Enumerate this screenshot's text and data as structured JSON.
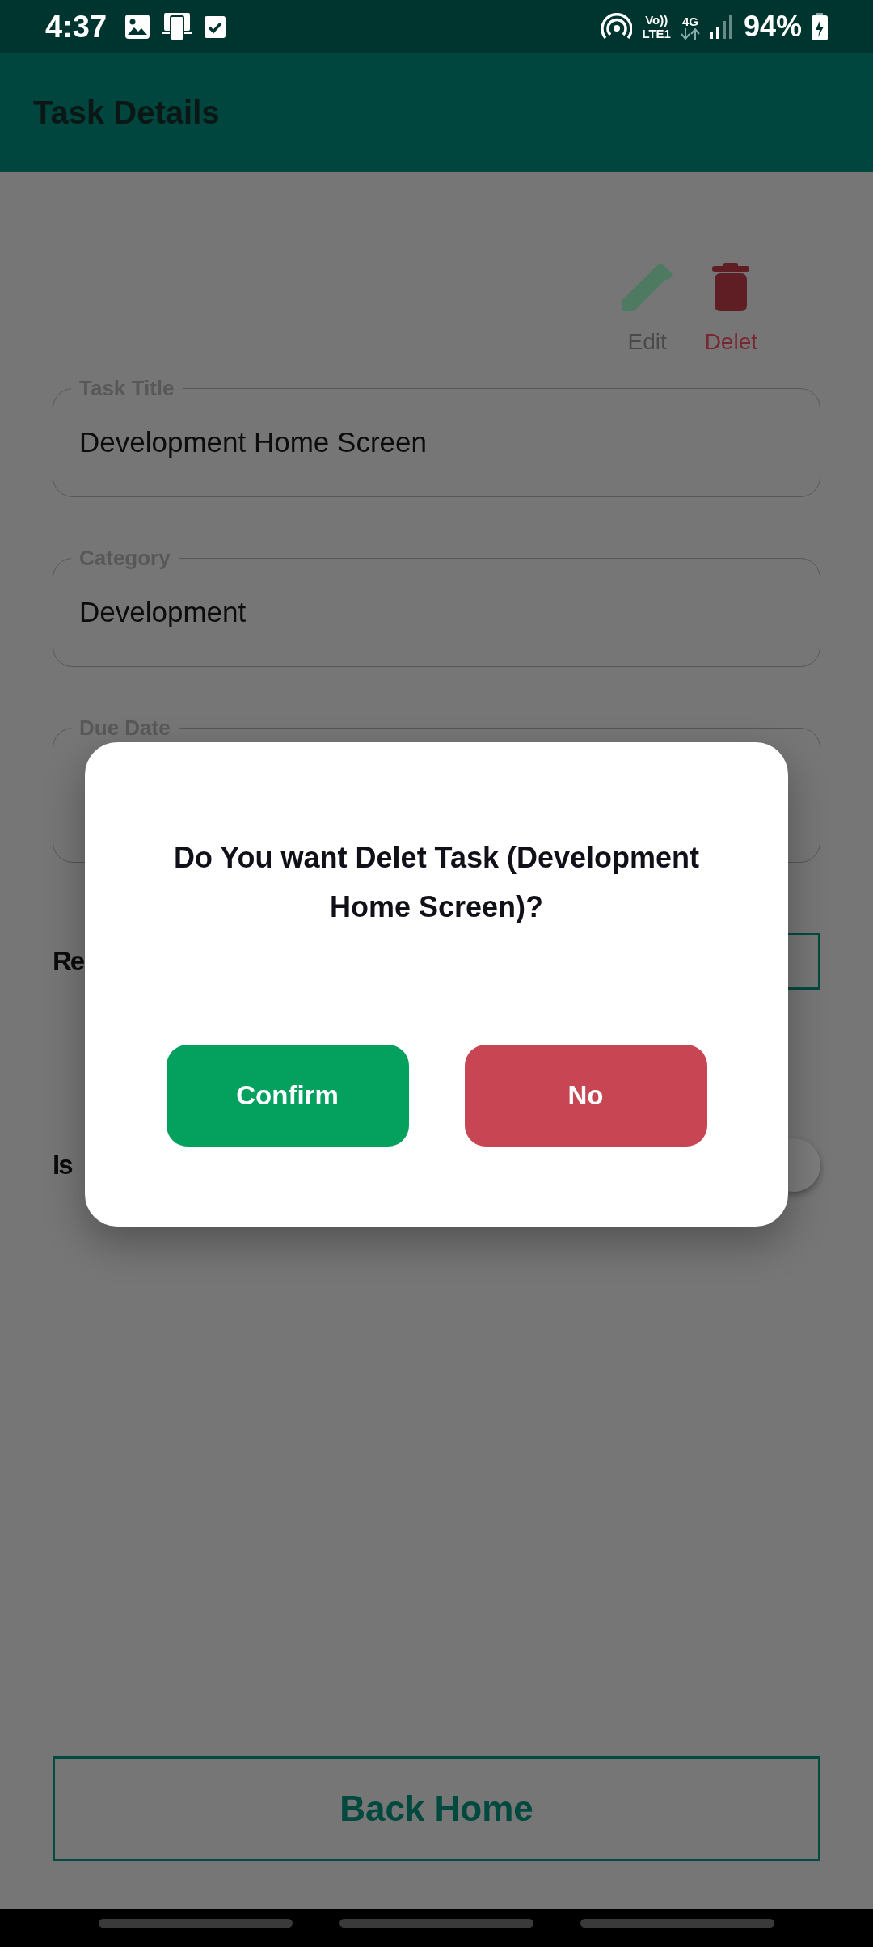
{
  "status_bar": {
    "time": "4:37",
    "volte": "Vo))",
    "lte": "LTE1",
    "network": "4G",
    "battery": "94%"
  },
  "app_bar": {
    "title": "Task Details"
  },
  "actions": [
    {
      "kind": "edit",
      "label": "Edit"
    },
    {
      "kind": "delete",
      "label": "Delet"
    }
  ],
  "fields": [
    {
      "label": "Task Title",
      "value": "Development Home Screen"
    },
    {
      "label": "Category",
      "value": "Development"
    },
    {
      "label": "Due Date"
    }
  ],
  "reminder": {
    "label": "Re"
  },
  "completed": {
    "label": "Is"
  },
  "back_button": {
    "label": "Back Home"
  },
  "dialog": {
    "message": "Do You want Delet Task (Development Home Screen)?",
    "buttons": [
      {
        "kind": "confirm",
        "label": "Confirm"
      },
      {
        "kind": "cancel",
        "label": "No"
      }
    ]
  }
}
